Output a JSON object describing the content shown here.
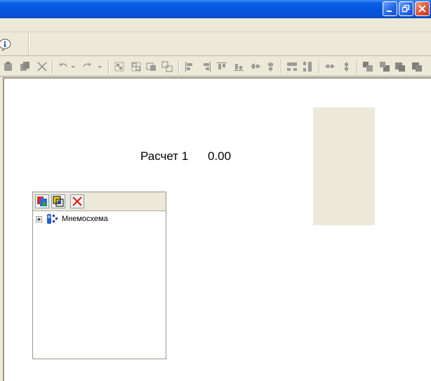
{
  "window": {
    "buttons": [
      "minimize",
      "restore",
      "close"
    ]
  },
  "toolbar1": {
    "icons": [
      "info-icon"
    ]
  },
  "toolbar2": {
    "icons": [
      "paste-icon",
      "copy-icon",
      "cut-icon",
      "undo-icon",
      "redo-icon",
      "group-icon",
      "ungroup-icon",
      "group-tool-icon",
      "ungroup-tool-icon",
      "align-left-icon",
      "align-right-icon",
      "align-top-icon",
      "align-bottom-icon",
      "align-hcenter-icon",
      "align-vcenter-icon",
      "space-horizontal-icon",
      "space-vertical-icon",
      "center-horizontal-icon",
      "center-vertical-icon",
      "bring-front-icon",
      "send-back-icon",
      "bring-forward-icon",
      "send-backward-icon"
    ]
  },
  "canvas": {
    "calc_label": "Расчет 1",
    "calc_value": "0.00",
    "rect_color": "#ece9d8"
  },
  "tree_panel": {
    "toolbar_icons": [
      "add-object-icon",
      "properties-icon",
      "delete-icon"
    ],
    "root_node": "Мнемосхема"
  },
  "colors": {
    "titlebar": "#0655de",
    "face": "#ece9d8",
    "delete": "#e0201a"
  }
}
